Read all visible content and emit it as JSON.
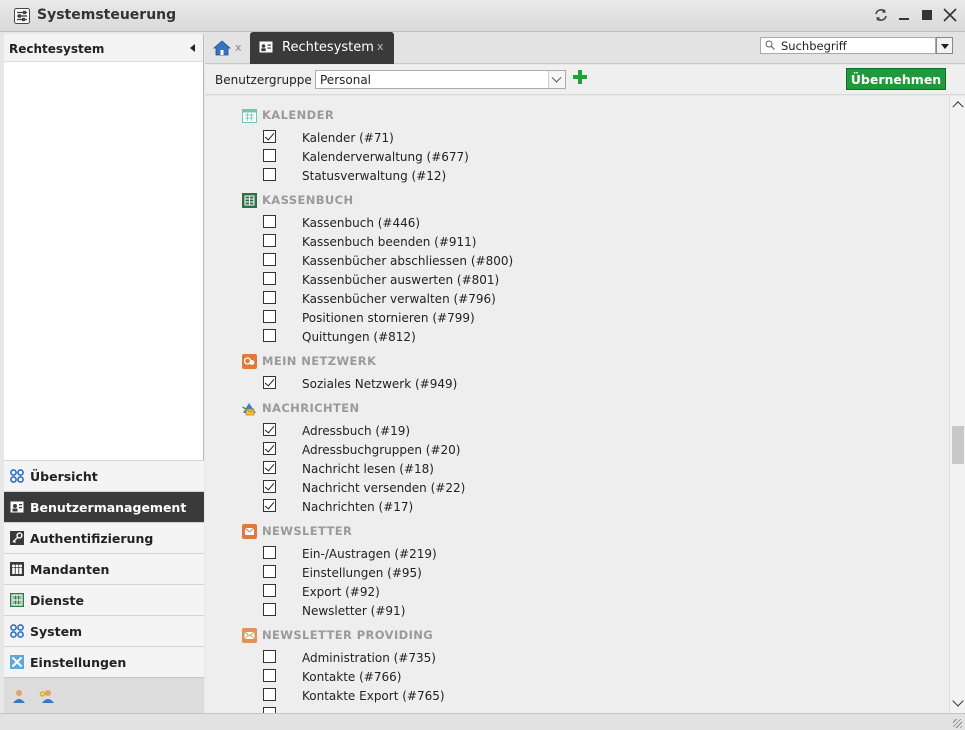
{
  "window": {
    "title": "Systemsteuerung"
  },
  "sidebar": {
    "header": "Rechtesystem",
    "items": [
      {
        "label": "Übersicht",
        "icon": "cluster-icon",
        "active": false
      },
      {
        "label": "Benutzermanagement",
        "icon": "users-admin-icon",
        "active": true
      },
      {
        "label": "Authentifizierung",
        "icon": "key-icon",
        "active": false
      },
      {
        "label": "Mandanten",
        "icon": "people-icon",
        "active": false
      },
      {
        "label": "Dienste",
        "icon": "services-icon",
        "active": false
      },
      {
        "label": "System",
        "icon": "cluster-icon",
        "active": false
      },
      {
        "label": "Einstellungen",
        "icon": "tools-icon",
        "active": false
      }
    ],
    "footer_icons": [
      "user-icon",
      "user-key-icon"
    ]
  },
  "tabs": {
    "home_close": "x",
    "active_label": "Rechtesystem",
    "active_close": "x"
  },
  "search": {
    "placeholder": "Suchbegriff",
    "value": "Suchbegriff"
  },
  "toolbar": {
    "group_label": "Benutzergruppe",
    "group_value": "Personal",
    "apply_label": "Übernehmen"
  },
  "categories": [
    {
      "title": "KALENDER",
      "icon": "calendar-icon",
      "color": "#6fc7b0",
      "items": [
        {
          "label": "Kalender (#71)",
          "checked": true
        },
        {
          "label": "Kalenderverwaltung (#677)",
          "checked": false
        },
        {
          "label": "Statusverwaltung (#12)",
          "checked": false
        }
      ]
    },
    {
      "title": "KASSENBUCH",
      "icon": "cashbook-icon",
      "color": "#2f6f4a",
      "items": [
        {
          "label": "Kassenbuch (#446)",
          "checked": false
        },
        {
          "label": "Kassenbuch beenden (#911)",
          "checked": false
        },
        {
          "label": "Kassenbücher abschliessen (#800)",
          "checked": false
        },
        {
          "label": "Kassenbücher auswerten (#801)",
          "checked": false
        },
        {
          "label": "Kassenbücher verwalten (#796)",
          "checked": false
        },
        {
          "label": "Positionen stornieren (#799)",
          "checked": false
        },
        {
          "label": "Quittungen (#812)",
          "checked": false
        }
      ]
    },
    {
      "title": "MEIN NETZWERK",
      "icon": "network-icon",
      "color": "#e07a3a",
      "items": [
        {
          "label": "Soziales Netzwerk (#949)",
          "checked": true
        }
      ]
    },
    {
      "title": "NACHRICHTEN",
      "icon": "messages-icon",
      "color": "#3a7bd5",
      "items": [
        {
          "label": "Adressbuch (#19)",
          "checked": true
        },
        {
          "label": "Adressbuchgruppen (#20)",
          "checked": true
        },
        {
          "label": "Nachricht lesen (#18)",
          "checked": true
        },
        {
          "label": "Nachricht versenden (#22)",
          "checked": true
        },
        {
          "label": "Nachrichten (#17)",
          "checked": true
        }
      ]
    },
    {
      "title": "NEWSLETTER",
      "icon": "newsletter-icon",
      "color": "#e07a3a",
      "items": [
        {
          "label": "Ein-/Austragen (#219)",
          "checked": false
        },
        {
          "label": "Einstellungen (#95)",
          "checked": false
        },
        {
          "label": "Export (#92)",
          "checked": false
        },
        {
          "label": "Newsletter (#91)",
          "checked": false
        }
      ]
    },
    {
      "title": "NEWSLETTER PROVIDING",
      "icon": "newsletter-providing-icon",
      "color": "#e0925a",
      "items": [
        {
          "label": "Administration (#735)",
          "checked": false
        },
        {
          "label": "Kontakte (#766)",
          "checked": false
        },
        {
          "label": "Kontakte Export (#765)",
          "checked": false
        }
      ]
    }
  ]
}
